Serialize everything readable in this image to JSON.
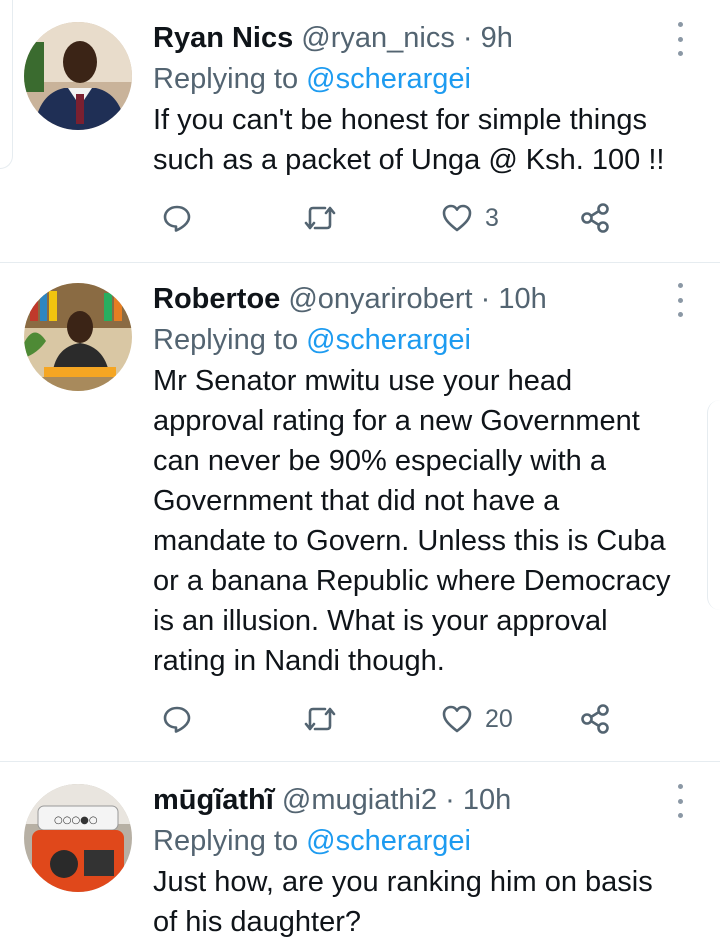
{
  "tweets": [
    {
      "name": "Ryan Nics",
      "handle": "@ryan_nics",
      "separator": "·",
      "time": "9h",
      "replying_prefix": "Replying to",
      "replying_to": "@scherargei",
      "text": "If you can't be honest for simple things such as a packet of Unga @ Ksh. 100 !!",
      "likes": "3",
      "icons": {
        "reply": "reply-icon",
        "retweet": "retweet-icon",
        "like": "heart-icon",
        "share": "share-icon",
        "more": "more-vertical-icon"
      }
    },
    {
      "name": "Robertoe",
      "handle": "@onyarirobert",
      "separator": "·",
      "time": "10h",
      "replying_prefix": "Replying to",
      "replying_to": "@scherargei",
      "text": "Mr Senator mwitu use your head approval rating for a new Government can never be 90% especially with a Government that did not have a mandate to Govern. Unless this is Cuba or a banana Republic where Democracy is an illusion. What is your approval rating in Nandi though.",
      "likes": "20",
      "icons": {
        "reply": "reply-icon",
        "retweet": "retweet-icon",
        "like": "heart-icon",
        "share": "share-icon",
        "more": "more-vertical-icon"
      }
    },
    {
      "name": "mūgĩathĩ",
      "handle": "@mugiathi2",
      "separator": "·",
      "time": "10h",
      "replying_prefix": "Replying to",
      "replying_to": "@scherargei",
      "text": "Just how, are you ranking him on basis of his daughter?",
      "icons": {
        "more": "more-vertical-icon"
      }
    }
  ],
  "colors": {
    "accent": "#1d9bf0",
    "text": "#0f1419",
    "muted": "#536471",
    "divider": "#e6ecf0"
  }
}
